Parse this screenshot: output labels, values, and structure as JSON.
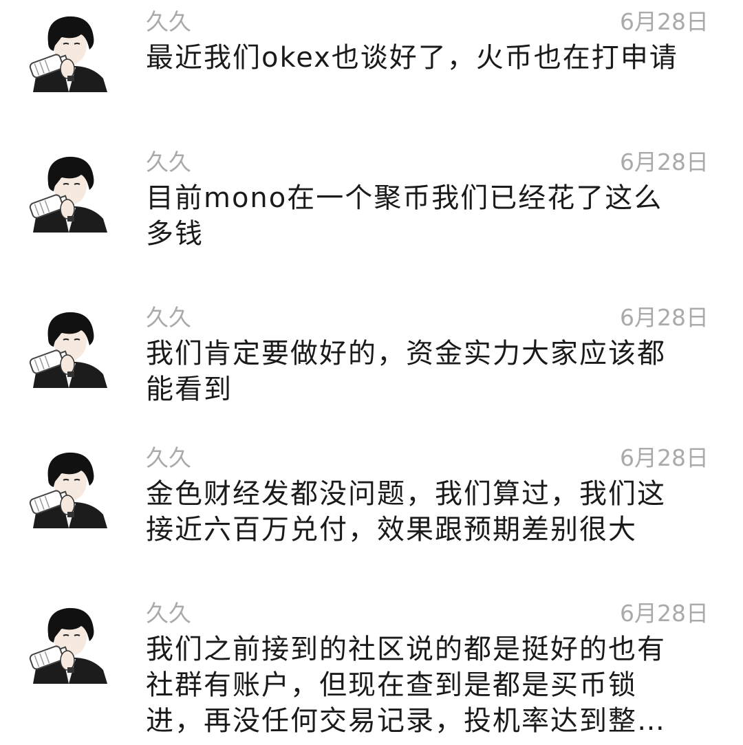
{
  "messages": [
    {
      "sender": "久久",
      "time": "6月28日",
      "avatar_icon": "avatar-boy-drinking-icon",
      "lines": [
        "最近我们okex也谈好了，火币也在打申请"
      ]
    },
    {
      "sender": "久久",
      "time": "6月28日",
      "avatar_icon": "avatar-boy-drinking-icon",
      "lines": [
        "目前mono在一个聚币我们已经花了这么",
        "多钱"
      ]
    },
    {
      "sender": "久久",
      "time": "6月28日",
      "avatar_icon": "avatar-boy-drinking-icon",
      "lines": [
        "我们肯定要做好的，资金实力大家应该都",
        "能看到"
      ]
    },
    {
      "sender": "久久",
      "time": "6月28日",
      "avatar_icon": "avatar-boy-drinking-icon",
      "lines": [
        "金色财经发都没问题，我们算过，我们这",
        "接近六百万兑付，效果跟预期差别很大"
      ]
    },
    {
      "sender": "久久",
      "time": "6月28日",
      "avatar_icon": "avatar-boy-drinking-icon",
      "lines": [
        "我们之前接到的社区说的都是挺好的也有",
        "社群有账户，但现在查到是都是买币锁",
        "进，再没任何交易记录，投机率达到整…"
      ]
    }
  ],
  "colors": {
    "background": "#ffffff",
    "meta_text": "#aaaaaa",
    "body_text": "#1a1a1a"
  }
}
